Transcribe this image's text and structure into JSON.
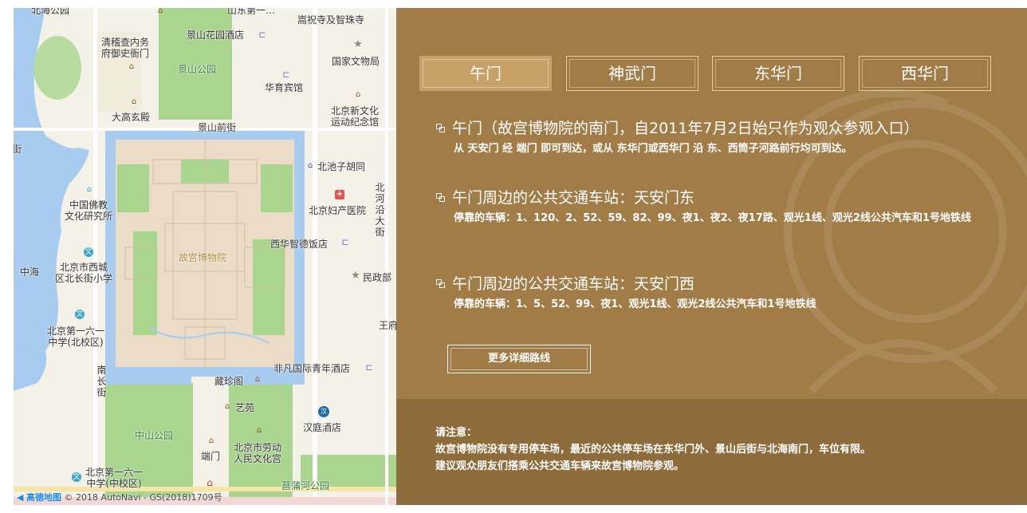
{
  "map": {
    "labels": {
      "beihai_park": "北海公园",
      "jingshan_first": "山东第一…",
      "songzhu_temple": "嵩祝寺及智珠寺",
      "jingshan_garden_hotel": "景山花园酒店",
      "qing_neiwu": "清稽查内务\n府御史衙门",
      "jingshan_park": "景山公园",
      "national_relics": "国家文物局",
      "huayu_hotel": "华育宾馆",
      "dagao_xuandian": "大高玄殿",
      "jingshan_front_st": "景山前街",
      "xinwenhua": "北京新文化\n运动纪念馆",
      "jie": "街",
      "beichizi": "北池子胡同",
      "buddhist_inst": "中国佛教\n文化研究所",
      "fuchan_hospital": "北京妇产医院",
      "beiheyan": "北河沿大街",
      "xihua_hotel": "西华智德饭店",
      "palace_museum": "故宫博物院",
      "zhonghai": "中海",
      "xicheng_school": "北京市西城\n区北长街小学",
      "minzheng": "民政部",
      "no161_north": "北京第一六一\n中学(北校区)",
      "wangfu": "王府",
      "nanchang_st": "南长街",
      "hostel": "非凡国际青年酒店",
      "zhenbao": "藏珍阁",
      "yiyuan": "艺苑",
      "hanting": "汉庭酒店",
      "zhongshan_park": "中山公园",
      "duanmen": "端门",
      "labor_palace": "北京市劳动\n人民文化宫",
      "no161_middle": "北京第一六一\n中学(中校区)",
      "changpu_park": "菖蒲河公园",
      "bus_text": "汉庭",
      "footer_logo": "高德地图",
      "footer_copy": "© 2018 AutoNavi - GS(2018)1709号"
    }
  },
  "tabs": [
    {
      "label": "午门",
      "active": true
    },
    {
      "label": "神武门",
      "active": false
    },
    {
      "label": "东华门",
      "active": false
    },
    {
      "label": "西华门",
      "active": false
    }
  ],
  "sections": [
    {
      "title": "午门（故宫博物院的南门，自2011年7月2日始只作为观众参观入口）",
      "desc": "从 天安门 经 端门 即可到达，或从 东华门或西华门 沿 东、西筒子河路前行均可到达。"
    },
    {
      "title": "午门周边的公共交通车站：天安门东",
      "desc": "停靠的车辆：1、120、2、52、59、82、99、夜1、夜2、夜17路、观光1线、观光2线公共汽车和1号地铁线"
    },
    {
      "title": "午门周边的公共交通车站：天安门西",
      "desc": "停靠的车辆：1、5、52、99、夜1、观光1线、观光2线公共汽车和1号地铁线"
    }
  ],
  "more_button": "更多详细路线",
  "notice": {
    "heading": "请注意：",
    "line1": "故宫博物院没有专用停车场，最近的公共停车场在东华门外、景山后街与北海南门，车位有限。",
    "line2": "建议观众朋友们搭乘公共交通车辆来故宫博物院参观。"
  },
  "colors": {
    "panel_bg": "#a27c47",
    "tab_active": "#c8a068",
    "notice_bg": "#8e6b3a",
    "water": "#a8ccf0",
    "green": "#a9d58f",
    "palace": "#eadcc7"
  },
  "icons": [
    "temple-icon",
    "hotel-icon",
    "star-icon",
    "hospital-icon",
    "school-icon",
    "bus-icon",
    "checkbox-icon",
    "autonavi-logo-icon"
  ]
}
